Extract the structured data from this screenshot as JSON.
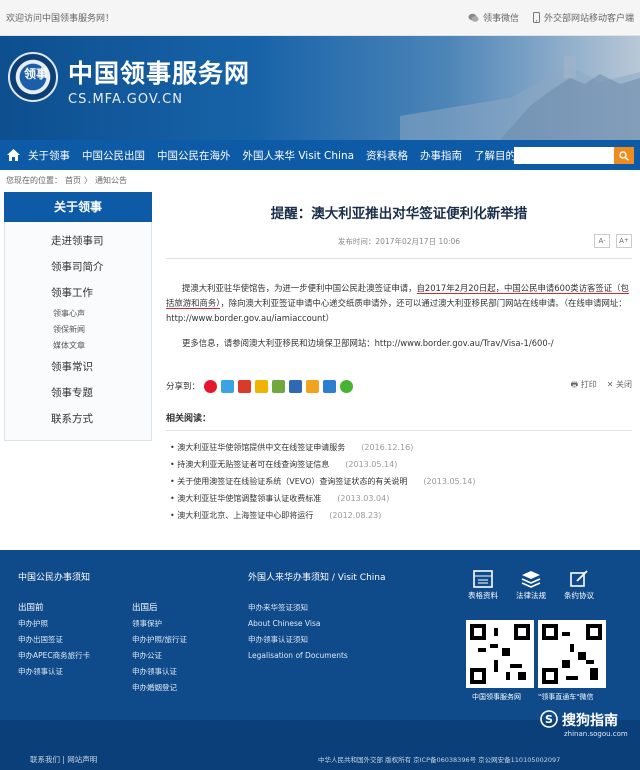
{
  "topbar": {
    "welcome": "欢迎访问中国领事服务网！",
    "link1": "领事微信",
    "link2": "外交部网站移动客户端"
  },
  "header": {
    "title": "中国领事服务网",
    "url": "CS.MFA.GOV.CN",
    "logo_text": "领事"
  },
  "nav": {
    "items": [
      "关于领事",
      "中国公民出国",
      "中国公民在海外",
      "外国人来华 Visit China",
      "资料表格",
      "办事指南",
      "了解目的地"
    ]
  },
  "breadcrumb": {
    "label": "您现在的位置：",
    "home": "首页",
    "sep": "〉",
    "current": "通知公告"
  },
  "sidebar": {
    "head": "关于领事",
    "items": [
      "走进领事司",
      "领事司简介",
      "领事工作"
    ],
    "subs": [
      "领事心声",
      "领保新闻",
      "媒体文章"
    ],
    "items2": [
      "领事常识",
      "领事专题",
      "联系方式"
    ]
  },
  "article": {
    "title": "提醒：澳大利亚推出对华签证便利化新举措",
    "meta": "发布时间：2017年02月17日 10:06",
    "p1a": "提澳大利亚驻华使馆告，为进一步便利中国公民赴澳签证申请，",
    "p1u": "自2017年2月20日起，中国公民申请600类访客签证（包括旅游和商务）",
    "p1b": "，除向澳大利亚签证申请中心递交纸质申请外，还可以通过澳大利亚移民部门网站在线申请。（在线申请网址：http://www.border.gov.au/iamiaccount）",
    "p2": "更多信息，请参阅澳大利亚移民和边境保卫部网站：http://www.border.gov.au/Trav/Visa-1/600-/",
    "share": "分享到：",
    "print": "打印",
    "close": "关闭",
    "related_head": "相关阅读：",
    "related": [
      {
        "title": "澳大利亚驻华使领馆提供中文在线签证申请服务",
        "date": "(2016.12.16)"
      },
      {
        "title": "持澳大利亚无贴签证者可在线查询签证信息",
        "date": "(2013.05.14)"
      },
      {
        "title": "关于使用澳签证在线验证系统（VEVO）查询签证状态的有关说明",
        "date": "(2013.05.14)"
      },
      {
        "title": "澳大利亚驻华使馆调整领事认证收费标准",
        "date": "(2013.03.04)"
      },
      {
        "title": "澳大利亚北京、上海签证中心即将运行",
        "date": "(2012.08.23)"
      }
    ]
  },
  "footer": {
    "h1": "中国公民办事须知",
    "h2": "外国人来华办事须知 / Visit China",
    "col1": {
      "title": "出国前",
      "items": [
        "申办护照",
        "申办出国签证",
        "申办APEC商务旅行卡",
        "申办领事认证"
      ]
    },
    "col2": {
      "title": "出国后",
      "items": [
        "领事保护",
        "申办护照/旅行证",
        "申办公证",
        "申办领事认证",
        "申办婚姻登记"
      ]
    },
    "col3": {
      "items": [
        "申办来华签证须知",
        "About Chinese Visa",
        "申办领事认证须知",
        "Legalisation of Documents"
      ]
    },
    "icons": [
      "表格资料",
      "法律法规",
      "条约协议"
    ],
    "qr1": "中国领事服务网",
    "qr2": "\"领事直通车\"微信"
  },
  "bottom": {
    "left": "联系我们 | 网站声明",
    "right": "中华人民共和国外交部  版权所有  京ICP备06038396号  京公网安备110105002097",
    "sogou": "搜狗指南",
    "sogou_url": "zhinan.sogou.com"
  }
}
